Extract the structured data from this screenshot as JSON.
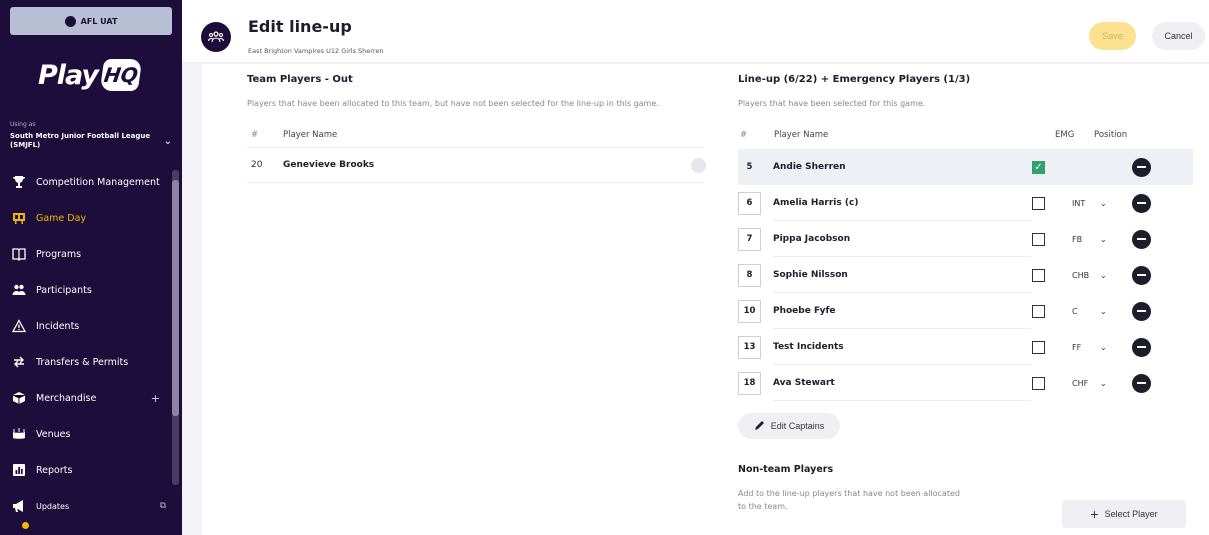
{
  "sidebar": {
    "env_label": "AFL UAT",
    "logo_text": "Play",
    "logo_mark": "HQ",
    "using_as_label": "Using as",
    "org_name": "South Metro Junior Football League (SMJFL)",
    "items": [
      {
        "label": "Competition Management",
        "icon": "trophy-icon",
        "active": false
      },
      {
        "label": "Game Day",
        "icon": "scoreboard-icon",
        "active": true
      },
      {
        "label": "Programs",
        "icon": "book-icon",
        "active": false
      },
      {
        "label": "Participants",
        "icon": "people-icon",
        "active": false
      },
      {
        "label": "Incidents",
        "icon": "warning-icon",
        "active": false
      },
      {
        "label": "Transfers & Permits",
        "icon": "transfer-icon",
        "active": false
      },
      {
        "label": "Merchandise",
        "icon": "box-icon",
        "active": false,
        "suffix": "+"
      },
      {
        "label": "Venues",
        "icon": "stadium-icon",
        "active": false
      },
      {
        "label": "Reports",
        "icon": "report-icon",
        "active": false
      },
      {
        "label": "Updates",
        "icon": "megaphone-icon",
        "active": false
      }
    ]
  },
  "header": {
    "title": "Edit line-up",
    "subtitle": "East Brighton Vampires U12 Girls Sherren",
    "save_label": "Save",
    "cancel_label": "Cancel"
  },
  "team_out": {
    "title": "Team Players - Out",
    "description": "Players that have been allocated to this team, but have not been selected for the line-up in this game.",
    "col_hash": "#",
    "col_name": "Player Name",
    "players": [
      {
        "number": "20",
        "name": "Genevieve Brooks"
      }
    ]
  },
  "lineup": {
    "title": "Line-up (6/22) + Emergency Players (1/3)",
    "description": "Players that have been selected for this game.",
    "col_hash": "#",
    "col_name": "Player Name",
    "col_emg": "EMG",
    "col_position": "Position",
    "players": [
      {
        "number": "5",
        "name": "Andie Sherren",
        "emg": true,
        "position": ""
      },
      {
        "number": "6",
        "name": "Amelia Harris (c)",
        "emg": false,
        "position": "INT"
      },
      {
        "number": "7",
        "name": "Pippa Jacobson",
        "emg": false,
        "position": "FB"
      },
      {
        "number": "8",
        "name": "Sophie Nilsson",
        "emg": false,
        "position": "CHB"
      },
      {
        "number": "10",
        "name": "Phoebe Fyfe",
        "emg": false,
        "position": "C"
      },
      {
        "number": "13",
        "name": "Test Incidents",
        "emg": false,
        "position": "FF"
      },
      {
        "number": "18",
        "name": "Ava Stewart",
        "emg": false,
        "position": "CHF"
      }
    ],
    "edit_captains_label": "Edit Captains"
  },
  "non_team": {
    "title": "Non-team Players",
    "description": "Add to the line-up players that have not been allocated to the team.",
    "select_player_label": "Select Player"
  },
  "colors": {
    "sidebar_bg": "#1d0d3a",
    "active_nav": "#f2b705",
    "emg_checked": "#2fa36b",
    "save_disabled": "#fbe190"
  }
}
